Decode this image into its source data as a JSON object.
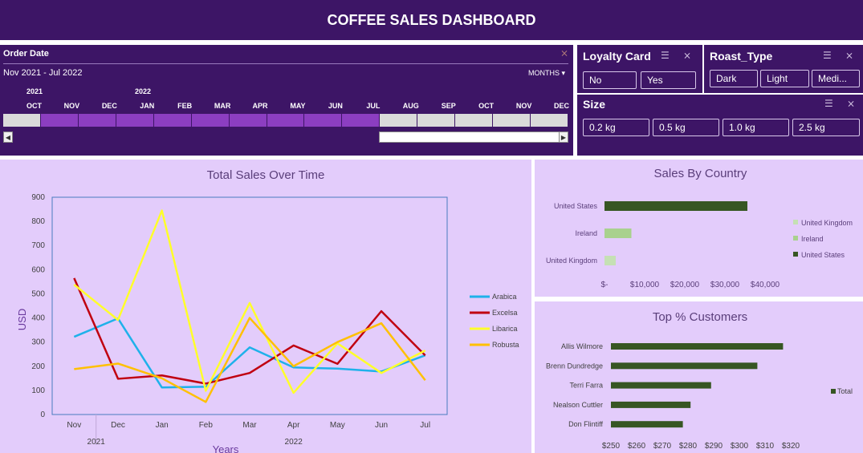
{
  "header": {
    "title": "COFFEE SALES DASHBOARD"
  },
  "timeline": {
    "title": "Order Date",
    "range_label": "Nov 2021 - Jul 2022",
    "level": "MONTHS",
    "years": [
      "2021",
      "2022"
    ],
    "months": [
      "OCT",
      "NOV",
      "DEC",
      "JAN",
      "FEB",
      "MAR",
      "APR",
      "MAY",
      "JUN",
      "JUL",
      "AUG",
      "SEP",
      "OCT",
      "NOV",
      "DEC"
    ],
    "selected": [
      false,
      true,
      true,
      true,
      true,
      true,
      true,
      true,
      true,
      true,
      false,
      false,
      false,
      false,
      false
    ]
  },
  "loyalty": {
    "title": "Loyalty Card",
    "options": [
      "No",
      "Yes"
    ]
  },
  "roast": {
    "title": "Roast_Type",
    "options": [
      "Dark",
      "Light",
      "Medi..."
    ]
  },
  "size": {
    "title": "Size",
    "options": [
      "0.2 kg",
      "0.5 kg",
      "1.0 kg",
      "2.5 kg"
    ]
  },
  "colors": {
    "header": "#3d1566",
    "panel_light": "#e3ccfb",
    "timeline_selected": "#8c3ec1",
    "timeline_unselected": "#dadada",
    "bar_us": "#375623",
    "bar_ireland": "#a9d18e",
    "bar_uk": "#c5e0b4"
  },
  "chart_data": [
    {
      "type": "line",
      "title": "Total Sales Over Time",
      "xlabel": "Years",
      "ylabel": "USD",
      "categories": [
        "Nov",
        "Dec",
        "Jan",
        "Feb",
        "Mar",
        "Apr",
        "May",
        "Jun",
        "Jul"
      ],
      "year_labels": [
        "2021",
        "2022"
      ],
      "ylim": [
        0,
        900
      ],
      "yticks": [
        "0",
        "100",
        "200",
        "300",
        "400",
        "500",
        "600",
        "700",
        "800",
        "900"
      ],
      "legend": "right",
      "series": [
        {
          "name": "Arabica",
          "color": "#1fb1ea",
          "values": [
            322,
            398,
            112,
            115,
            278,
            195,
            190,
            178,
            245
          ]
        },
        {
          "name": "Excelsa",
          "color": "#c00010",
          "values": [
            565,
            148,
            162,
            128,
            172,
            286,
            210,
            428,
            245
          ]
        },
        {
          "name": "Libarica",
          "color": "#ffff2a",
          "values": [
            538,
            392,
            845,
            98,
            462,
            90,
            295,
            172,
            265
          ]
        },
        {
          "name": "Robusta",
          "color": "#ffc000",
          "values": [
            188,
            211,
            150,
            52,
            400,
            200,
            300,
            378,
            142
          ]
        }
      ]
    },
    {
      "type": "bar",
      "orientation": "horizontal",
      "title": "Sales  By Country",
      "categories": [
        "United States",
        "Ireland",
        "United Kingdom"
      ],
      "values": [
        35600,
        6700,
        2800
      ],
      "xlim": [
        0,
        40000
      ],
      "xticks": [
        "$-",
        "$10,000",
        "$20,000",
        "$30,000",
        "$40,000"
      ],
      "legend_entries": [
        "United Kingdom",
        "Ireland",
        "United States"
      ]
    },
    {
      "type": "bar",
      "orientation": "horizontal",
      "title": "Top % Customers",
      "categories": [
        "Allis Wilmore",
        "Brenn Dundredge",
        "Terri Farra",
        "Nealson Cuttler",
        "Don Flintiff"
      ],
      "values": [
        317,
        307,
        289,
        281,
        278
      ],
      "xlim": [
        250,
        320
      ],
      "xticks": [
        "$250",
        "$260",
        "$270",
        "$280",
        "$290",
        "$300",
        "$310",
        "$320"
      ],
      "legend_entries": [
        "Total"
      ]
    }
  ]
}
